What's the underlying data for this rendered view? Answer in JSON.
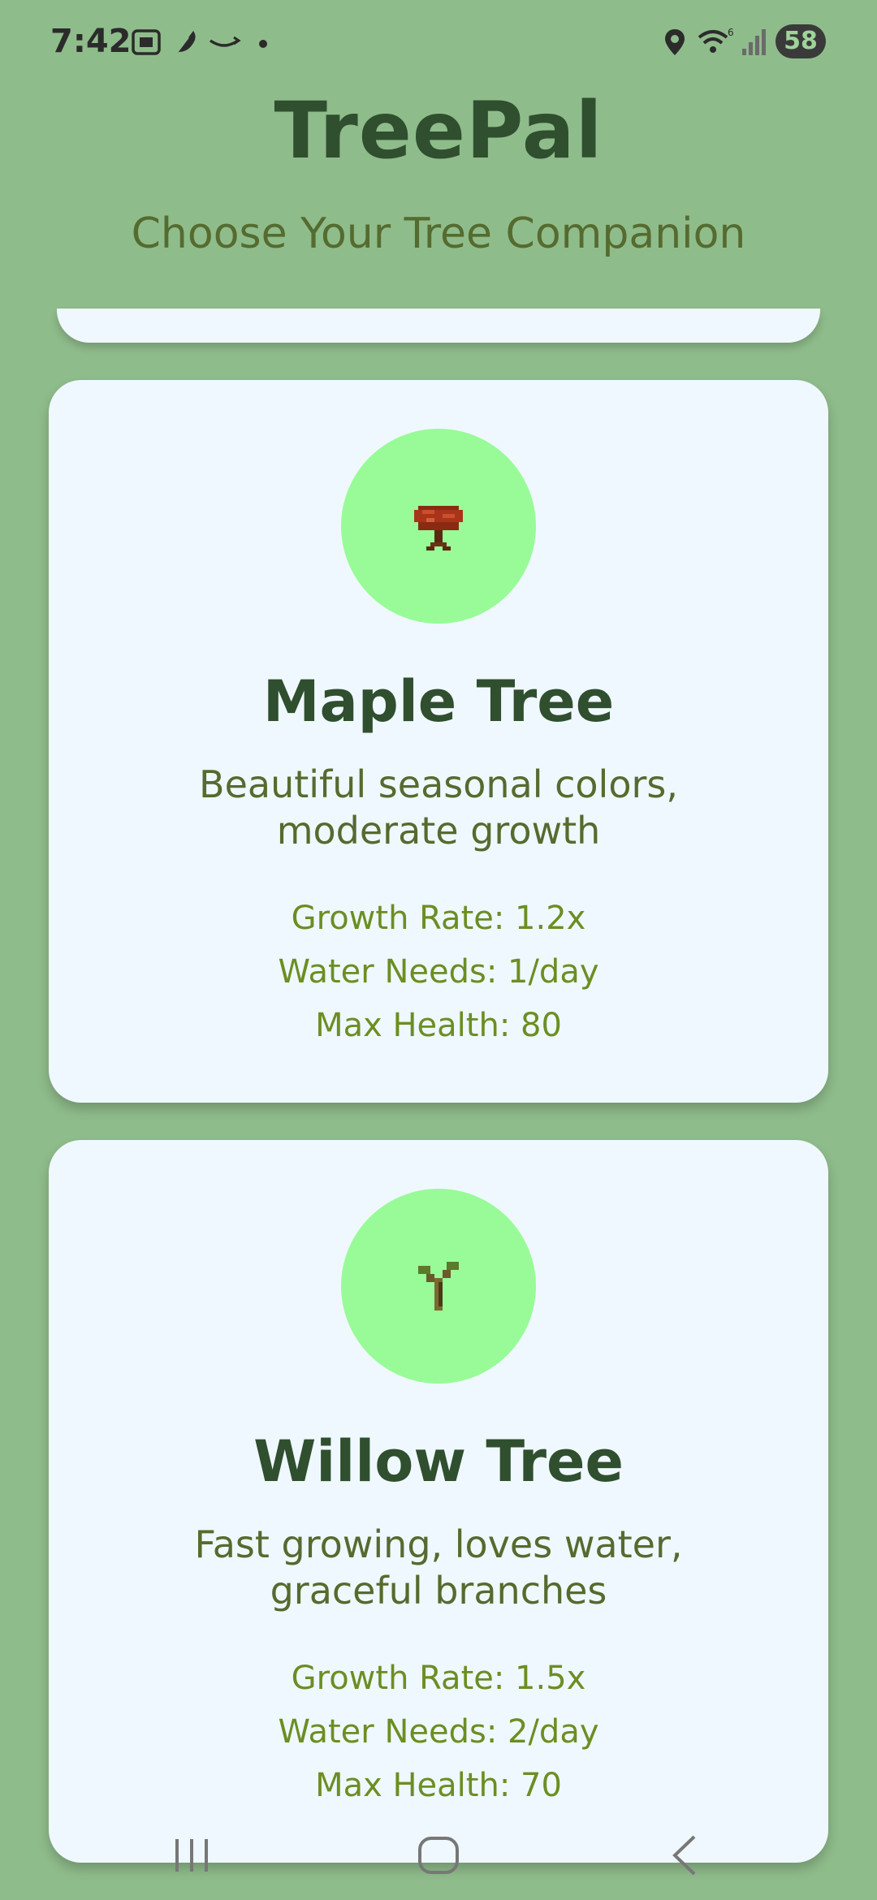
{
  "status_bar": {
    "time": "7:42",
    "battery": "58",
    "icons": [
      "screenshot-icon",
      "feather-icon",
      "amazon-smile-icon",
      "dot-icon",
      "location-icon",
      "wifi-icon",
      "signal-icon",
      "battery-icon"
    ]
  },
  "header": {
    "title": "TreePal",
    "subtitle": "Choose Your Tree Companion"
  },
  "trees": [
    {
      "name": "Maple Tree",
      "description": "Beautiful seasonal colors, moderate growth",
      "growth_rate": "Growth Rate: 1.2x",
      "water_needs": "Water Needs: 1/day",
      "max_health": "Max Health: 80",
      "icon": "maple-tree-icon"
    },
    {
      "name": "Willow Tree",
      "description": "Fast growing, loves water, graceful branches",
      "growth_rate": "Growth Rate: 1.5x",
      "water_needs": "Water Needs: 2/day",
      "max_health": "Max Health: 70",
      "icon": "willow-sapling-icon"
    }
  ],
  "nav_bar": {
    "buttons": [
      "recent-apps-button",
      "home-button",
      "back-button"
    ]
  },
  "colors": {
    "background": "#8fbc8b",
    "card": "#f0f8ff",
    "avatar": "#98fb98",
    "title": "#2f4f2f",
    "subtitle": "#556b2f",
    "stat": "#6b8e23"
  }
}
